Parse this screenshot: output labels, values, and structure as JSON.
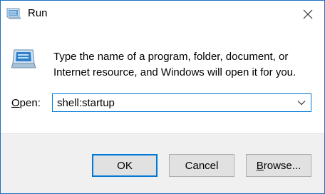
{
  "window": {
    "title": "Run",
    "accent": "#0078d7",
    "close_icon": "close-icon",
    "app_icon": "run-icon"
  },
  "content": {
    "message_line1": "Type the name of a program, folder, document, or",
    "message_line2": "Internet resource, and Windows will open it for you.",
    "open_label_access": "O",
    "open_label_rest": "pen:",
    "input_value": "shell:startup",
    "dropdown_icon": "chevron-down-icon"
  },
  "buttons": {
    "ok": "OK",
    "cancel": "Cancel",
    "browse_access": "B",
    "browse_rest": "rowse..."
  }
}
